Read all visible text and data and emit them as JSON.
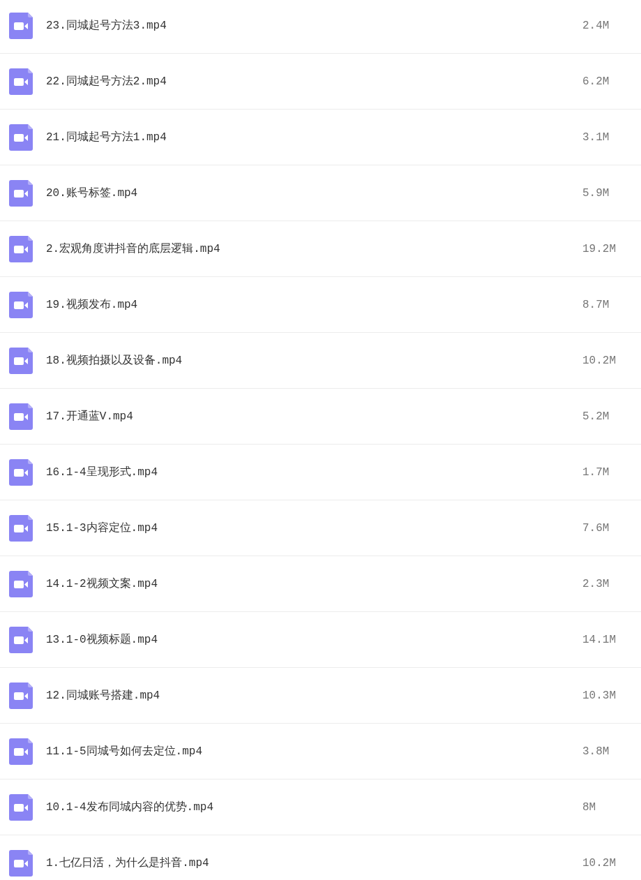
{
  "files": [
    {
      "name": "23.同城起号方法3.mp4",
      "size": "2.4M"
    },
    {
      "name": "22.同城起号方法2.mp4",
      "size": "6.2M"
    },
    {
      "name": "21.同城起号方法1.mp4",
      "size": "3.1M"
    },
    {
      "name": "20.账号标签.mp4",
      "size": "5.9M"
    },
    {
      "name": "2.宏观角度讲抖音的底层逻辑.mp4",
      "size": "19.2M"
    },
    {
      "name": "19.视频发布.mp4",
      "size": "8.7M"
    },
    {
      "name": "18.视频拍摄以及设备.mp4",
      "size": "10.2M"
    },
    {
      "name": "17.开通蓝V.mp4",
      "size": "5.2M"
    },
    {
      "name": "16.1-4呈现形式.mp4",
      "size": "1.7M"
    },
    {
      "name": "15.1-3内容定位.mp4",
      "size": "7.6M"
    },
    {
      "name": "14.1-2视频文案.mp4",
      "size": "2.3M"
    },
    {
      "name": "13.1-0视频标题.mp4",
      "size": "14.1M"
    },
    {
      "name": "12.同城账号搭建.mp4",
      "size": "10.3M"
    },
    {
      "name": "11.1-5同城号如何去定位.mp4",
      "size": "3.8M"
    },
    {
      "name": "10.1-4发布同城内容的优势.mp4",
      "size": "8M"
    },
    {
      "name": "1.七亿日活，为什么是抖音.mp4",
      "size": "10.2M"
    }
  ]
}
